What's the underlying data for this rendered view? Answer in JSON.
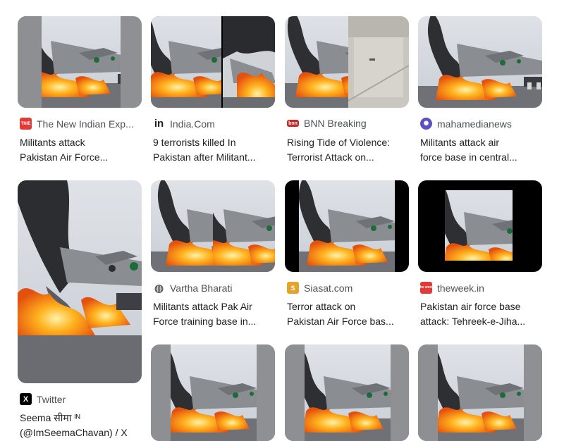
{
  "results": [
    {
      "source": "The New Indian Exp...",
      "icon": "tnie-icon",
      "icon_color": "#e53935",
      "title_lines": [
        "Militants attack",
        "Pakistan Air Force..."
      ]
    },
    {
      "source": "India.Com",
      "icon": "indiacom-icon",
      "icon_color": "#202124",
      "title_lines": [
        "9 terrorists killed In",
        "Pakistan after Militant..."
      ]
    },
    {
      "source": "BNN Breaking",
      "icon": "bnn-icon",
      "icon_color": "#c62828",
      "title_lines": [
        "Rising Tide of Violence:",
        "Terrorist Attack on..."
      ]
    },
    {
      "source": "mahamedianews",
      "icon": "globe-purple-icon",
      "icon_color": "#5b4fc4",
      "title_lines": [
        "Militants attack air",
        "force base in central..."
      ]
    },
    {
      "source": "Twitter",
      "icon": "x-logo-icon",
      "icon_color": "#000000",
      "title_lines": [
        "Seema सीमा ᴵᴺ",
        "(@ImSeemaChavan) / X"
      ]
    },
    {
      "source": "Vartha Bharati",
      "icon": "globe-icon",
      "icon_color": "#5f6368",
      "title_lines": [
        "Militants attack Pak Air",
        "Force training base in..."
      ]
    },
    {
      "source": "Siasat.com",
      "icon": "siasat-icon",
      "icon_color": "#e5a32b",
      "title_lines": [
        "Terror attack on",
        "Pakistan Air Force bas..."
      ]
    },
    {
      "source": "theweek.in",
      "icon": "theweek-icon",
      "icon_color": "#e53935",
      "title_lines": [
        "Pakistan air force base",
        "attack: Tehreek-e-Jiha..."
      ]
    },
    {
      "source": "",
      "icon": "",
      "icon_color": "",
      "title_lines": []
    },
    {
      "source": "",
      "icon": "",
      "icon_color": "",
      "title_lines": []
    },
    {
      "source": "",
      "icon": "",
      "icon_color": "",
      "title_lines": []
    }
  ],
  "icon_text": {
    "tnie": "TNIE",
    "indiacom": "in",
    "bnn": "bnn",
    "x": "X",
    "siasat": "S",
    "theweek": "the week"
  }
}
